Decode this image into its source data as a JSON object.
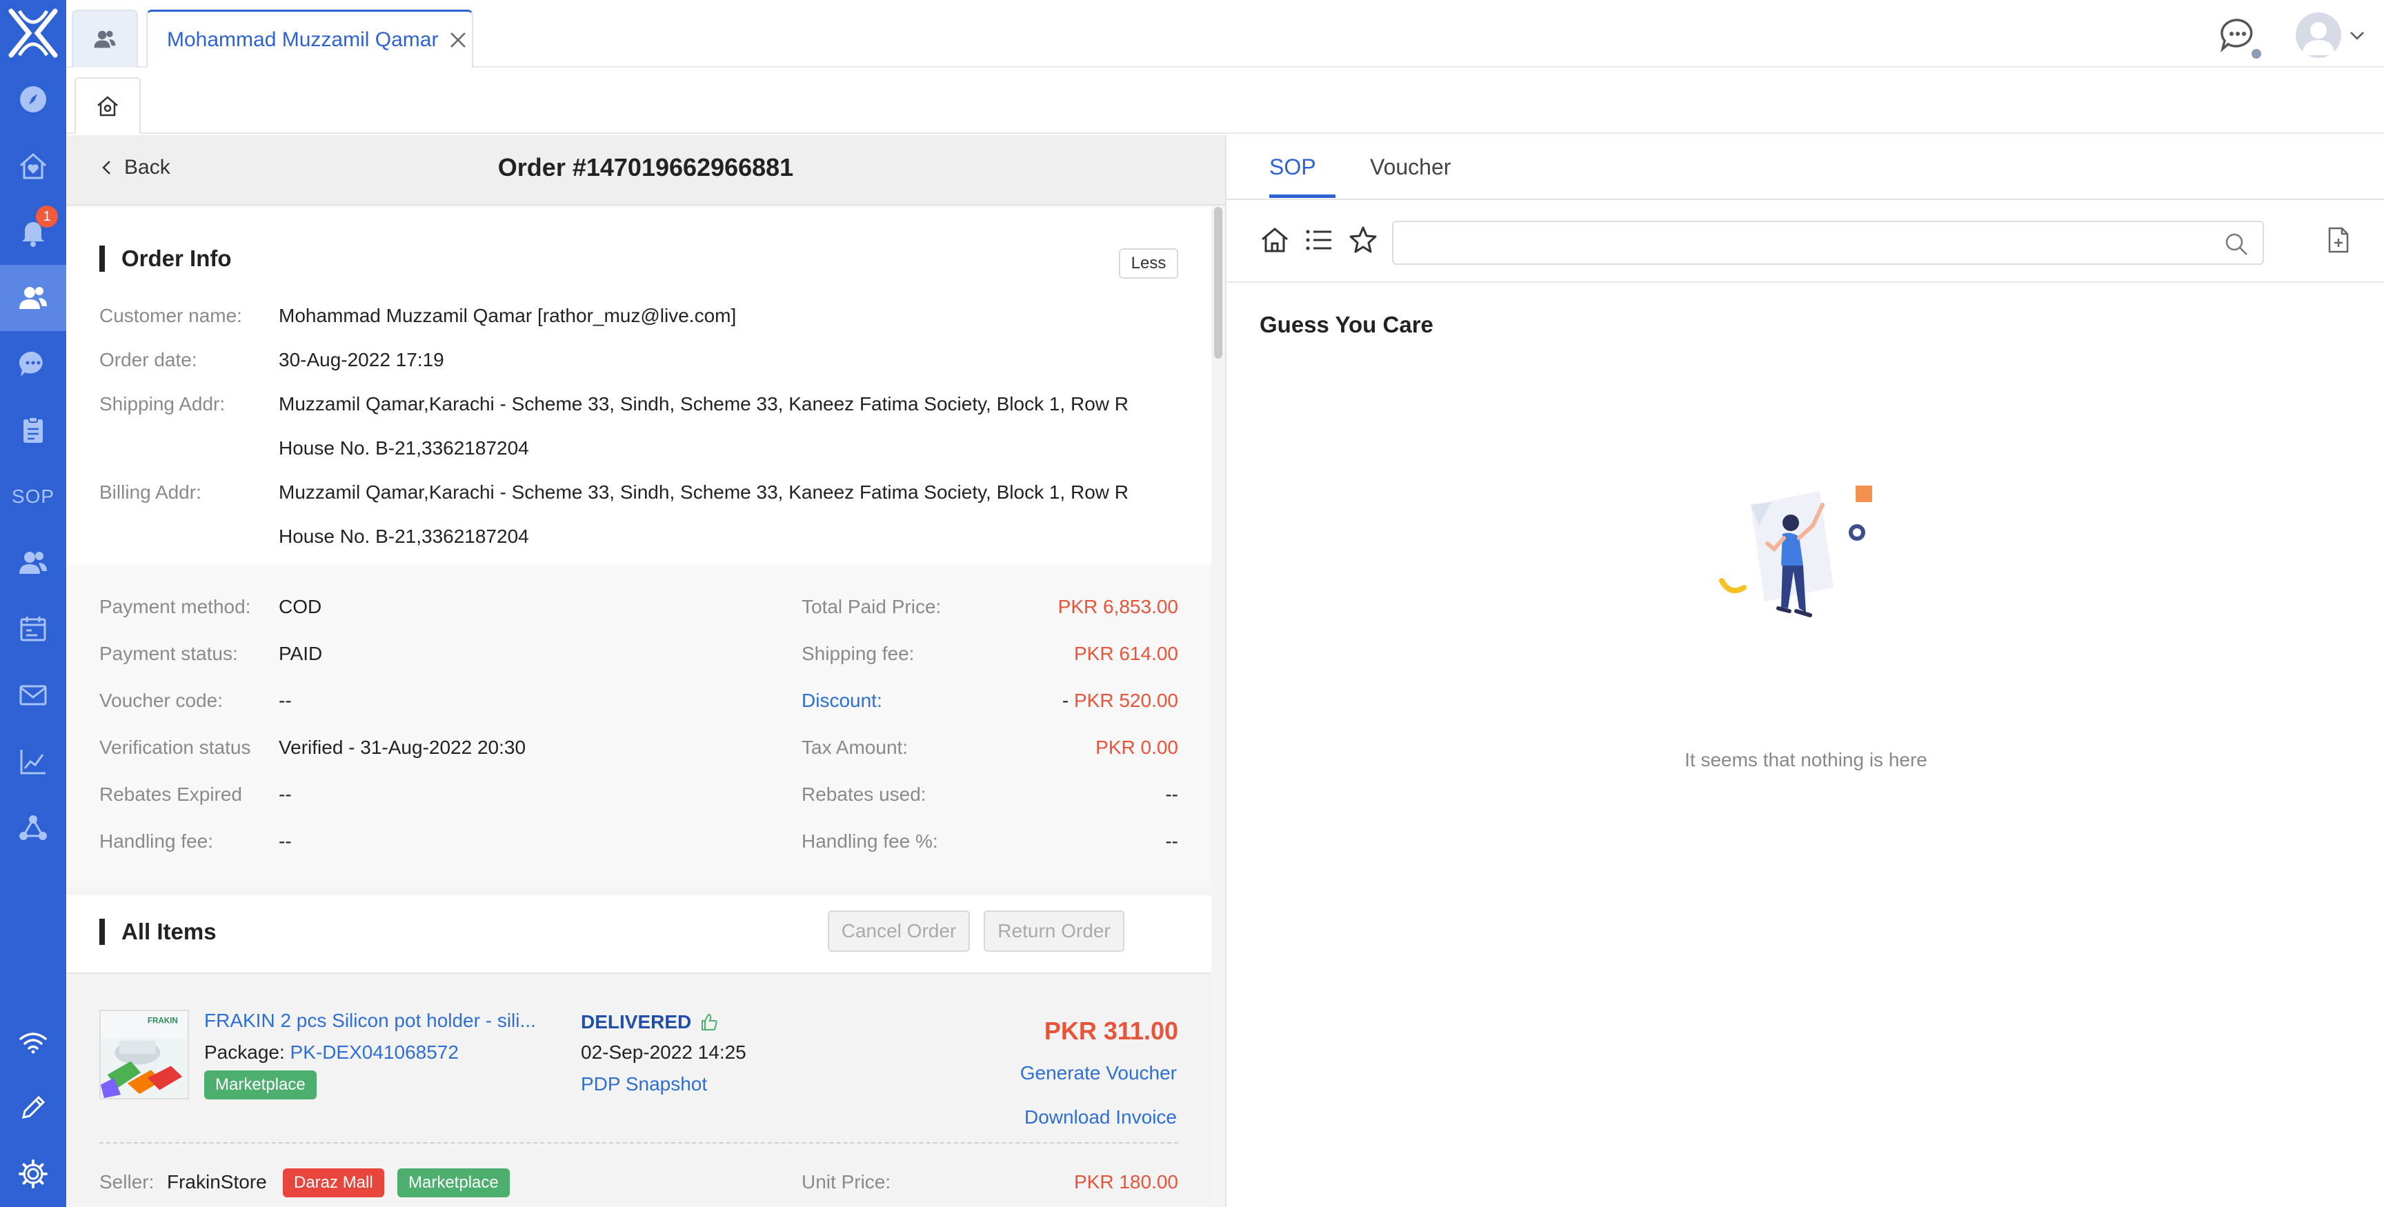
{
  "top": {
    "tab_label": "Mohammad Muzzamil Qamar"
  },
  "sidebar": {
    "badge_count": "1",
    "sop_label": "SOP"
  },
  "order": {
    "back_label": "Back",
    "title": "Order #147019662966881"
  },
  "order_info": {
    "title": "Order Info",
    "less_button": "Less",
    "customer_label": "Customer name:",
    "customer_value": "Mohammad Muzzamil Qamar [rathor_muz@live.com]",
    "date_label": "Order date:",
    "date_value": "30-Aug-2022 17:19",
    "shipping_label": "Shipping Addr:",
    "shipping_line1": "Muzzamil Qamar,Karachi - Scheme 33, Sindh, Scheme 33, Kaneez Fatima Society, Block 1, Row R",
    "shipping_line2": "House No. B-21,3362187204",
    "billing_label": "Billing Addr:",
    "billing_line1": "Muzzamil Qamar,Karachi - Scheme 33, Sindh, Scheme 33, Kaneez Fatima Society, Block 1, Row R",
    "billing_line2": "House No. B-21,3362187204"
  },
  "payment": {
    "method_label": "Payment method:",
    "method_value": "COD",
    "status_label": "Payment status:",
    "status_value": "PAID",
    "voucher_label": "Voucher code:",
    "voucher_value": "--",
    "verification_label": "Verification status",
    "verification_value": "Verified - 31-Aug-2022 20:30",
    "rebates_expired_label": "Rebates Expired",
    "rebates_expired_value": "--",
    "handling_label": "Handling fee:",
    "handling_value": "--",
    "total_label": "Total Paid Price:",
    "total_value": "PKR 6,853.00",
    "shipping_fee_label": "Shipping fee:",
    "shipping_fee_value": "PKR 614.00",
    "discount_label": "Discount:",
    "discount_prefix": "- ",
    "discount_value": "PKR 520.00",
    "tax_label": "Tax Amount:",
    "tax_value": "PKR 0.00",
    "rebates_used_label": "Rebates used:",
    "rebates_used_value": "--",
    "handling_pct_label": "Handling fee %:",
    "handling_pct_value": "--"
  },
  "items": {
    "title": "All Items",
    "cancel_button": "Cancel Order",
    "return_button": "Return Order",
    "list": [
      {
        "name": "FRAKIN 2 pcs Silicon pot holder - sili...",
        "package_label": "Package:",
        "package_id": "PK-DEX041068572",
        "tag": "Marketplace",
        "status": "DELIVERED",
        "date": "02-Sep-2022 14:25",
        "snapshot_link": "PDP Snapshot",
        "price": "PKR 311.00",
        "voucher_link": "Generate Voucher",
        "invoice_link": "Download Invoice",
        "seller_label": "Seller:",
        "seller_value": "FrakinStore",
        "seller_tag1": "Daraz Mall",
        "seller_tag2": "Marketplace",
        "unit_price_label": "Unit Price:",
        "unit_price_value": "PKR 180.00",
        "thumb_brand": "FRAKIN"
      }
    ]
  },
  "right": {
    "tabs": [
      "SOP",
      "Voucher"
    ],
    "search_value": "",
    "guess_title": "Guess You Care",
    "empty_text": "It seems that nothing is here"
  },
  "colors": {
    "sidebar": "#2e62d4",
    "accent": "#2e62d4",
    "price_red": "#e8543a",
    "link_blue": "#2e6fd6",
    "tag_green": "#4caf6e",
    "tag_red": "#e8453c"
  }
}
